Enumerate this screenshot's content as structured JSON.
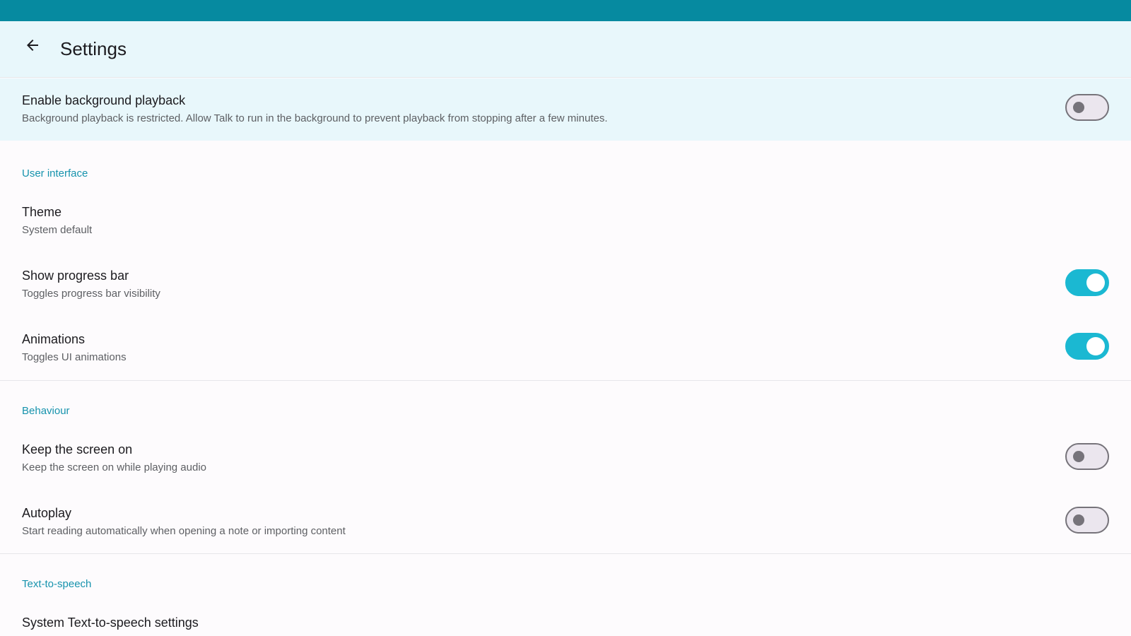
{
  "app_bar": {
    "title": "Settings",
    "back_icon": "arrow-back-icon"
  },
  "background_playback": {
    "title": "Enable background playback",
    "subtitle": "Background playback is restricted. Allow Talk to run in the background to prevent playback from stopping after a few minutes.",
    "enabled": false
  },
  "sections": {
    "user_interface": {
      "header": "User interface",
      "theme": {
        "title": "Theme",
        "subtitle": "System default"
      },
      "progress_bar": {
        "title": "Show progress bar",
        "subtitle": "Toggles progress bar visibility",
        "enabled": true
      },
      "animations": {
        "title": "Animations",
        "subtitle": "Toggles UI animations",
        "enabled": true
      }
    },
    "behaviour": {
      "header": "Behaviour",
      "keep_screen_on": {
        "title": "Keep the screen on",
        "subtitle": "Keep the screen on while playing audio",
        "enabled": false
      },
      "autoplay": {
        "title": "Autoplay",
        "subtitle": "Start reading automatically when opening a note or importing content",
        "enabled": false
      }
    },
    "tts": {
      "header": "Text-to-speech",
      "system_tts": {
        "title": "System Text-to-speech settings"
      }
    }
  },
  "colors": {
    "status_bar": "#068aa0",
    "app_bar": "#e8f7fb",
    "accent": "#1bb8d2",
    "section_header": "#1693ad"
  }
}
